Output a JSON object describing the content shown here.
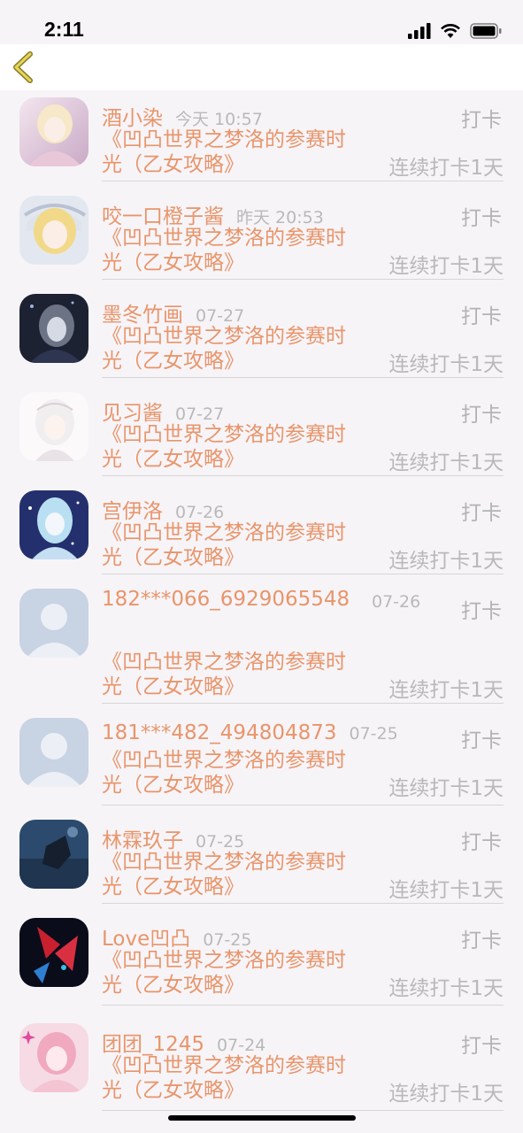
{
  "status_bar": {
    "time": "2:11"
  },
  "colors": {
    "accent": "#e8956a",
    "muted": "#b9b9b9",
    "divider": "#d6d6d6",
    "back_arrow": "#cfc24a"
  },
  "list": [
    {
      "name": "酒小染",
      "time": "今天 10:57",
      "action": "打卡",
      "title": "《凹凸世界之梦洛的参赛时光（乙女攻略》",
      "streak": "连续打卡1天"
    },
    {
      "name": "咬一口橙子酱",
      "time": "昨天 20:53",
      "action": "打卡",
      "title": "《凹凸世界之梦洛的参赛时光（乙女攻略》",
      "streak": "连续打卡1天"
    },
    {
      "name": "墨冬竹画",
      "time": "07-27",
      "action": "打卡",
      "title": "《凹凸世界之梦洛的参赛时光（乙女攻略》",
      "streak": "连续打卡1天"
    },
    {
      "name": "见习酱",
      "time": "07-27",
      "action": "打卡",
      "title": "《凹凸世界之梦洛的参赛时光（乙女攻略》",
      "streak": "连续打卡1天"
    },
    {
      "name": "宫伊洛",
      "time": "07-26",
      "action": "打卡",
      "title": "《凹凸世界之梦洛的参赛时光（乙女攻略》",
      "streak": "连续打卡1天"
    },
    {
      "name": "182***066_6929065548",
      "time": "07-26",
      "action": "打卡",
      "title": "《凹凸世界之梦洛的参赛时光（乙女攻略》",
      "streak": "连续打卡1天"
    },
    {
      "name": "181***482_494804873",
      "time": "07-25",
      "action": "打卡",
      "title": "《凹凸世界之梦洛的参赛时光（乙女攻略》",
      "streak": "连续打卡1天"
    },
    {
      "name": "林霖玖子",
      "time": "07-25",
      "action": "打卡",
      "title": "《凹凸世界之梦洛的参赛时光（乙女攻略》",
      "streak": "连续打卡1天"
    },
    {
      "name": "Love凹凸",
      "time": "07-25",
      "action": "打卡",
      "title": "《凹凸世界之梦洛的参赛时光（乙女攻略》",
      "streak": "连续打卡1天"
    },
    {
      "name": "团团_1245",
      "time": "07-24",
      "action": "打卡",
      "title": "《凹凸世界之梦洛的参赛时光（乙女攻略》",
      "streak": "连续打卡1天"
    }
  ]
}
